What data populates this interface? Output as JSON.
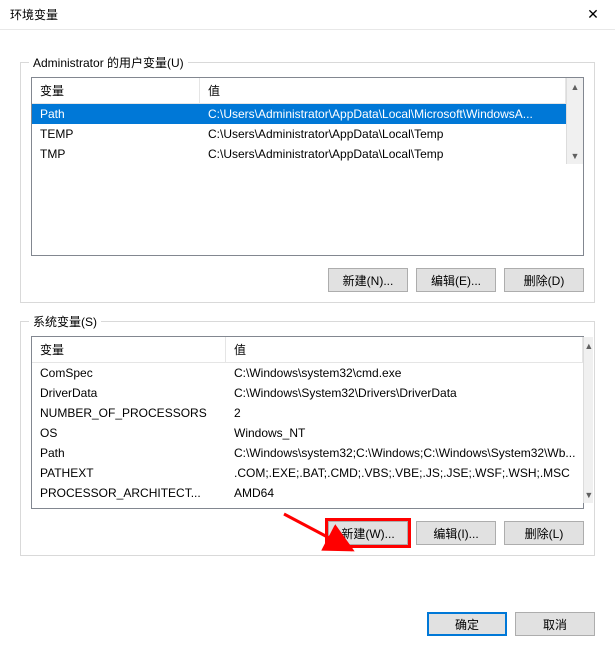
{
  "window": {
    "title": "环境变量",
    "close_glyph": "✕"
  },
  "userVars": {
    "groupLabel": "Administrator 的用户变量(U)",
    "cols": {
      "var": "变量",
      "val": "值"
    },
    "rows": [
      {
        "var": "Path",
        "val": "C:\\Users\\Administrator\\AppData\\Local\\Microsoft\\WindowsA...",
        "selected": true
      },
      {
        "var": "TEMP",
        "val": "C:\\Users\\Administrator\\AppData\\Local\\Temp"
      },
      {
        "var": "TMP",
        "val": "C:\\Users\\Administrator\\AppData\\Local\\Temp"
      }
    ],
    "buttons": {
      "new": "新建(N)...",
      "edit": "编辑(E)...",
      "del": "删除(D)"
    }
  },
  "sysVars": {
    "groupLabel": "系统变量(S)",
    "cols": {
      "var": "变量",
      "val": "值"
    },
    "rows": [
      {
        "var": "ComSpec",
        "val": "C:\\Windows\\system32\\cmd.exe"
      },
      {
        "var": "DriverData",
        "val": "C:\\Windows\\System32\\Drivers\\DriverData"
      },
      {
        "var": "NUMBER_OF_PROCESSORS",
        "val": "2"
      },
      {
        "var": "OS",
        "val": "Windows_NT"
      },
      {
        "var": "Path",
        "val": "C:\\Windows\\system32;C:\\Windows;C:\\Windows\\System32\\Wb..."
      },
      {
        "var": "PATHEXT",
        "val": ".COM;.EXE;.BAT;.CMD;.VBS;.VBE;.JS;.JSE;.WSF;.WSH;.MSC"
      },
      {
        "var": "PROCESSOR_ARCHITECT...",
        "val": "AMD64"
      }
    ],
    "buttons": {
      "new": "新建(W)...",
      "edit": "编辑(I)...",
      "del": "删除(L)"
    }
  },
  "footer": {
    "ok": "确定",
    "cancel": "取消"
  },
  "scroll": {
    "up": "▲",
    "down": "▼"
  }
}
